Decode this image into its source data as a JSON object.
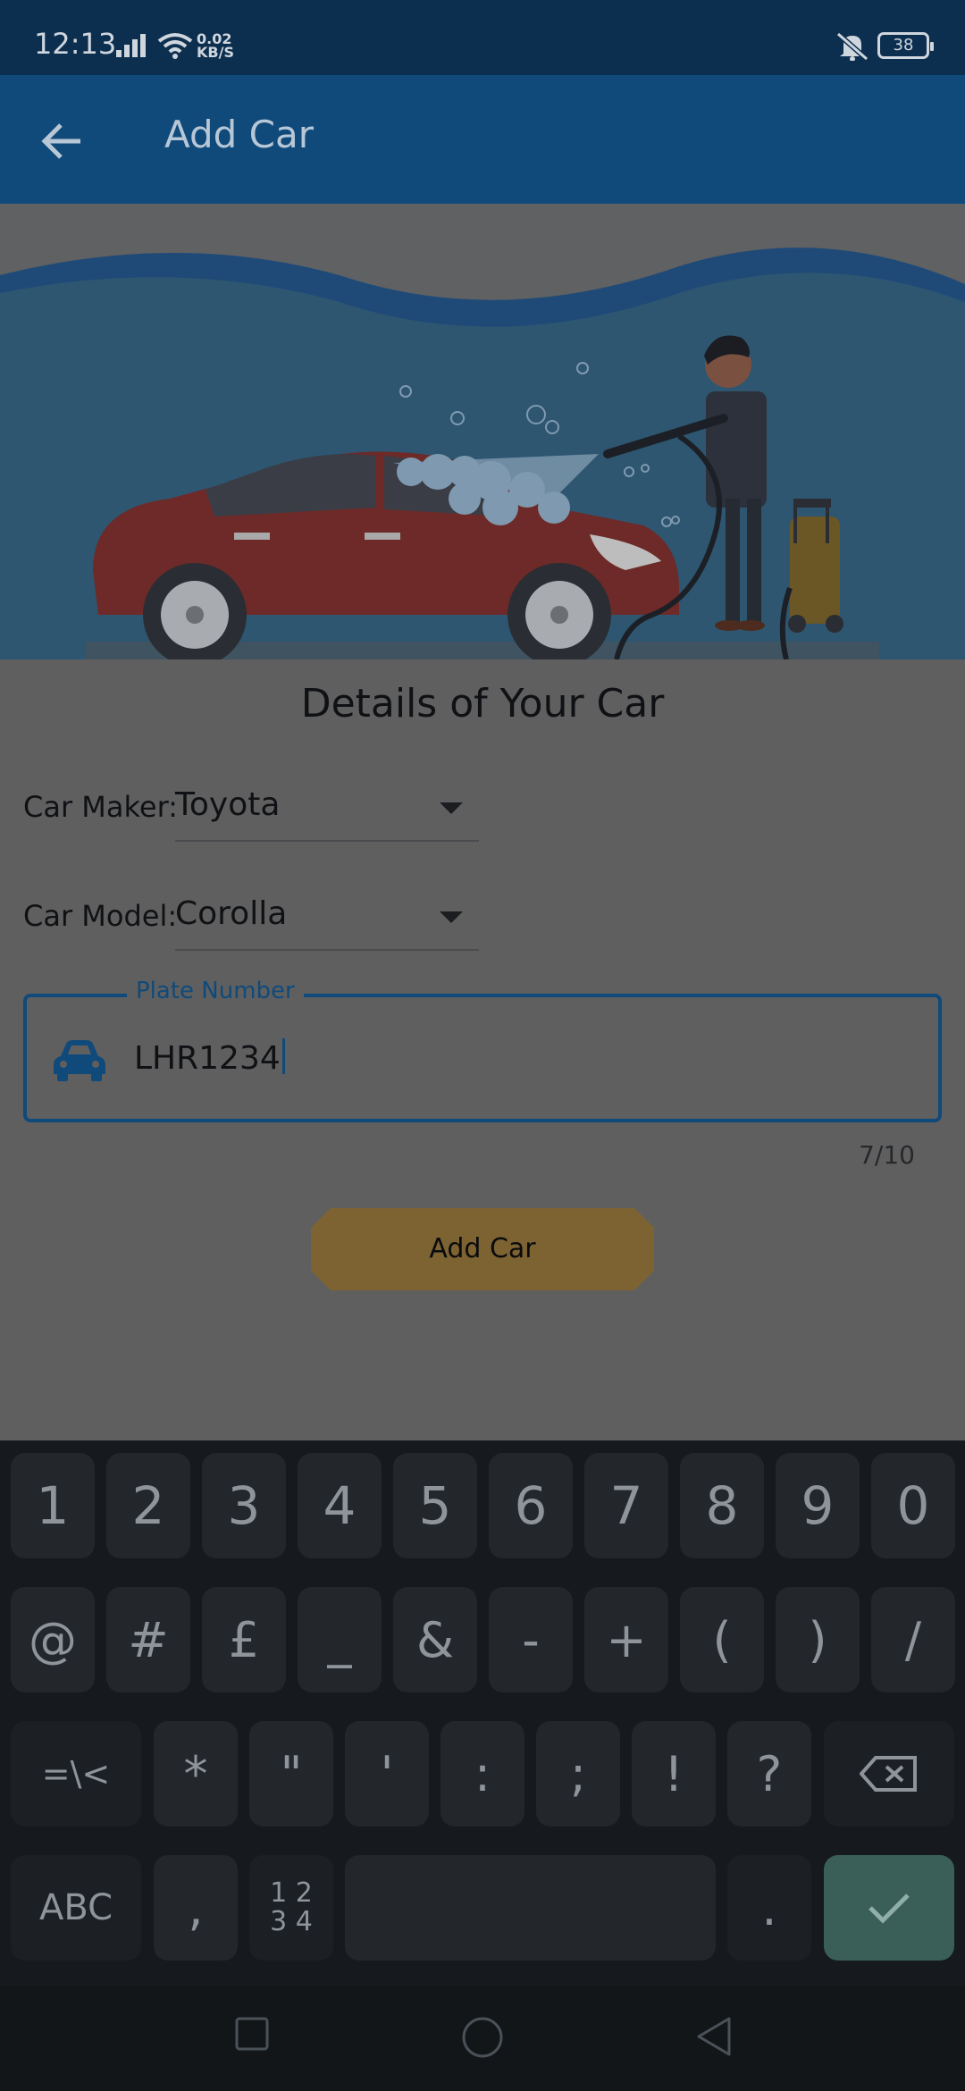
{
  "status_bar": {
    "time": "12:13",
    "net_speed_value": "0.02",
    "net_speed_unit": "KB/S",
    "battery": "38",
    "icons": [
      "signal-icon",
      "wifi-icon",
      "mute-icon",
      "battery-icon"
    ]
  },
  "app_bar": {
    "back_icon": "arrow-left-icon",
    "title": "Add Car",
    "color": "#0f4a7b"
  },
  "hero": {
    "image": "car-wash-illustration"
  },
  "form": {
    "title": "Details of Your Car",
    "maker": {
      "label": "Car Maker:",
      "value": "Toyota"
    },
    "model": {
      "label": "Car Model:",
      "value": "Corolla"
    },
    "plate": {
      "legend": "Plate Number",
      "value": "LHR1234",
      "icon": "car-icon",
      "counter": "7/10"
    },
    "submit_label": "Add Car"
  },
  "keyboard": {
    "row1": [
      "1",
      "2",
      "3",
      "4",
      "5",
      "6",
      "7",
      "8",
      "9",
      "0"
    ],
    "row2": [
      "@",
      "#",
      "£",
      "_",
      "&",
      "-",
      "+",
      "(",
      ")",
      "/"
    ],
    "row3": [
      "=\\<",
      "*",
      "\"",
      "'",
      ":",
      ";",
      "!",
      "?"
    ],
    "row4": {
      "abc": "ABC",
      "comma": ",",
      "numpad": "1 2\n3 4",
      "period": ".",
      "done_icon": "check-icon",
      "backspace_icon": "backspace-icon"
    }
  },
  "nav_bar": {
    "icons": [
      "recents-icon",
      "home-icon",
      "back-icon"
    ]
  }
}
